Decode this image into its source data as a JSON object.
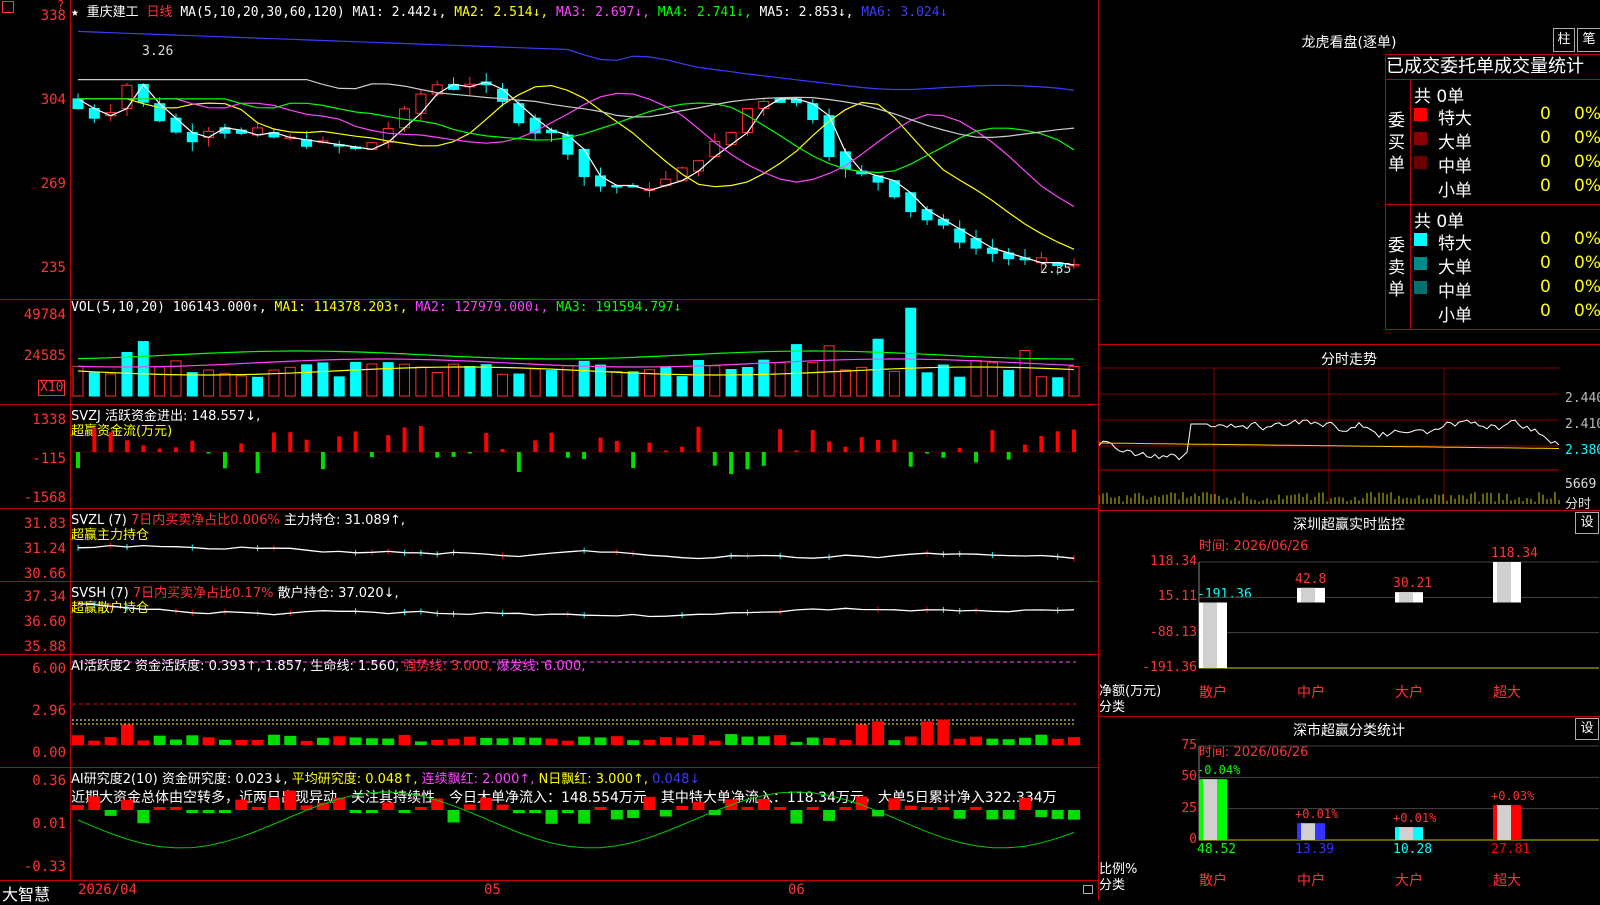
{
  "kline": {
    "stock_name": "重庆建工",
    "period": "日线",
    "ma_params": "MA(5,10,20,30,60,120)",
    "ma1": "MA1: 2.442↓,",
    "ma2": "MA2: 2.514↓,",
    "ma3": "MA3: 2.697↓,",
    "ma4": "MA4: 2.741↓,",
    "ma5": "MA5: 2.853↓,",
    "ma6": "MA6: 3.024↓",
    "ticks": [
      "338",
      "304",
      "269",
      "235"
    ],
    "high_label": "3.26",
    "low_label": "2.35"
  },
  "vol": {
    "params": "VOL(5,10,20)",
    "value": "106143.000↑,",
    "ma1": "MA1: 114378.203↑,",
    "ma2": "MA2: 127979.000↓,",
    "ma3": "MA3: 191594.797↓",
    "ticks": [
      "49784",
      "24585"
    ],
    "unit": "X10"
  },
  "svzj": {
    "header": "SVZJ  活跃资金进出: 148.557↓,",
    "sub": "超赢资金流(万元)",
    "ticks": [
      "1338",
      "-115",
      "-1568"
    ]
  },
  "svzl": {
    "header_a": "SVZL (7)",
    "header_b": "7日内买卖净占比0.006%",
    "header_c": "主力持仓: 31.089↑,",
    "sub": "超赢主力持仓",
    "ticks": [
      "31.83",
      "31.24",
      "30.66"
    ]
  },
  "svsh": {
    "header_a": "SVSH (7)",
    "header_b": "7日内买卖净占比0.17%",
    "header_c": "散户持仓: 37.020↓,",
    "sub": "超赢散户持仓",
    "ticks": [
      "37.34",
      "36.60",
      "35.88"
    ]
  },
  "ai1": {
    "header_a": "AI活跃度2 资金活跃度: 0.393↑, 1.857, 生命线: 1.560,",
    "header_b": "强势线: 3.000,",
    "header_c": "爆发线: 6.000,",
    "ticks": [
      "6.00",
      "2.96",
      "0.00"
    ]
  },
  "ai2": {
    "header_a": "AI研究度2(10) 资金研究度: 0.023↓,",
    "header_b": "平均研究度: 0.048↑,",
    "header_c": "连续飘红: 2.000↑,",
    "header_d": "N日飘红: 3.000↑,",
    "header_e": "0.048↓",
    "comment": "近期大资金总体由空转多，近两日出现异动，关注其持续性，今日大单净流入：148.554万元，其中特大单净流入：118.34万元，大单5日累计净入322.334万",
    "ticks": [
      "0.36",
      "0.01",
      "-0.33"
    ]
  },
  "footer": {
    "app": "大智慧",
    "dates": [
      "2026/04",
      "05",
      "06"
    ]
  },
  "dragon": {
    "title": "龙虎看盘(逐单)",
    "btn1": "柱",
    "btn2": "笔",
    "subtitle": "已成交委托单成交量统计",
    "buy_label": "委买单",
    "sell_label": "委卖单",
    "buy_total": "共 0单",
    "sell_total": "共 0单",
    "rows": [
      {
        "name": "特大",
        "count": "0",
        "pct": "0%"
      },
      {
        "name": "大单",
        "count": "0",
        "pct": "0%"
      },
      {
        "name": "中单",
        "count": "0",
        "pct": "0%"
      },
      {
        "name": "小单",
        "count": "0",
        "pct": "0%"
      }
    ],
    "buy_colors": [
      "#ff0000",
      "#8b0000",
      "#6b0000",
      "#000000"
    ],
    "sell_colors": [
      "#00ffff",
      "#008b8b",
      "#007070",
      "#000000"
    ]
  },
  "intraday": {
    "title": "分时走势",
    "ticks": [
      "2.440",
      "2.410",
      "2.380",
      "5669",
      "分时"
    ]
  },
  "monitor": {
    "title": "深圳超赢实时监控",
    "btn": "设",
    "time": "时间: 2026/06/26",
    "ticks": [
      "118.34",
      "15.11",
      "-88.13",
      "-191.36"
    ],
    "yunit_a": "净额(万元)",
    "yunit_b": "分类",
    "categories": [
      "散户",
      "中户",
      "大户",
      "超大"
    ],
    "values": [
      -191.36,
      42.8,
      30.21,
      118.34
    ],
    "labels": [
      "-191.36",
      "42.8",
      "30.21",
      "118.34"
    ]
  },
  "classify": {
    "title": "深市超赢分类统计",
    "btn": "设",
    "time": "时间: 2026/06/26",
    "ticks": [
      "75",
      "50",
      "25",
      "0"
    ],
    "yunit_a": "比例%",
    "yunit_b": "分类",
    "categories": [
      "散户",
      "中户",
      "大户",
      "超大"
    ],
    "values": [
      48.52,
      13.39,
      10.28,
      27.81
    ],
    "changes": [
      "-0.04%",
      "+0.01%",
      "+0.01%",
      "+0.03%"
    ],
    "labels": [
      "48.52",
      "13.39",
      "10.28",
      "27.81"
    ],
    "colors": [
      "#00ff00",
      "#3333ff",
      "#00ffff",
      "#ff0000"
    ]
  }
}
